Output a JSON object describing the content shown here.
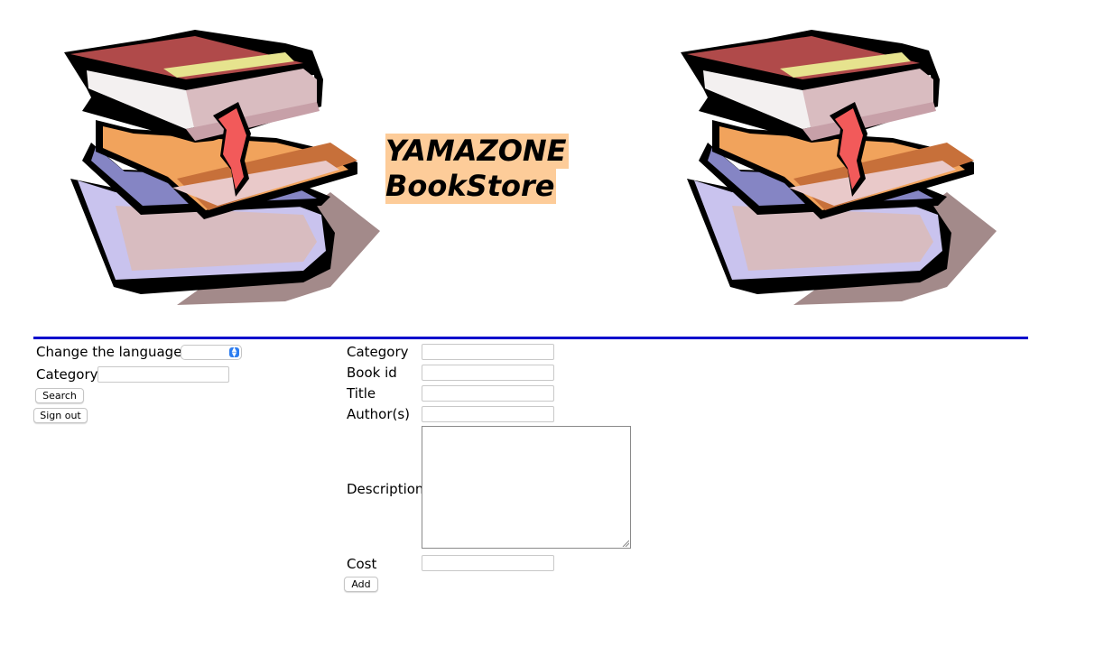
{
  "header": {
    "brand_line1": "YAMAZONE",
    "brand_line2": "BookStore",
    "brand_highlight_color": "#fdcc99",
    "left_image_icon": "book-stack-icon",
    "right_image_icon": "book-stack-icon"
  },
  "divider_color": "#0000cc",
  "sidebar": {
    "language_label": "Change the language:",
    "language_value": "",
    "category_label": "Category",
    "category_value": "",
    "search_label": "Search",
    "signout_label": "Sign out"
  },
  "add_form": {
    "category_label": "Category",
    "book_id_label": "Book id",
    "title_label": "Title",
    "authors_label": "Author(s)",
    "description_label": "Description",
    "cost_label": "Cost",
    "add_label": "Add",
    "category_value": "",
    "book_id_value": "",
    "title_value": "",
    "authors_value": "",
    "description_value": "",
    "cost_value": ""
  }
}
